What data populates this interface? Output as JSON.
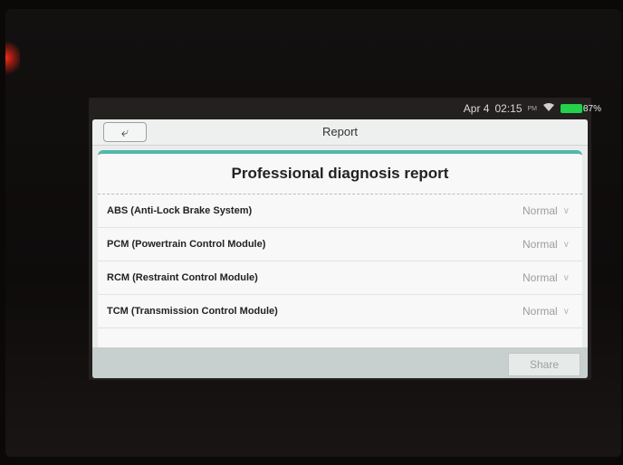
{
  "status_bar": {
    "date": "Apr 4",
    "time": "02:15",
    "ampm": "PM",
    "battery_pct": "87%",
    "wifi_icon": "wifi-icon",
    "battery_icon": "battery-icon",
    "battery_color": "#23d14a"
  },
  "header": {
    "title": "Report",
    "back_icon": "back-arrow-icon"
  },
  "report": {
    "heading": "Professional diagnosis report",
    "items": [
      {
        "name": "ABS (Anti-Lock Brake System)",
        "status": "Normal"
      },
      {
        "name": "PCM (Powertrain Control Module)",
        "status": "Normal"
      },
      {
        "name": "RCM (Restraint Control Module)",
        "status": "Normal"
      },
      {
        "name": "TCM (Transmission Control Module)",
        "status": "Normal"
      }
    ],
    "accent_color": "#53b7a9"
  },
  "footer": {
    "share_label": "Share"
  }
}
